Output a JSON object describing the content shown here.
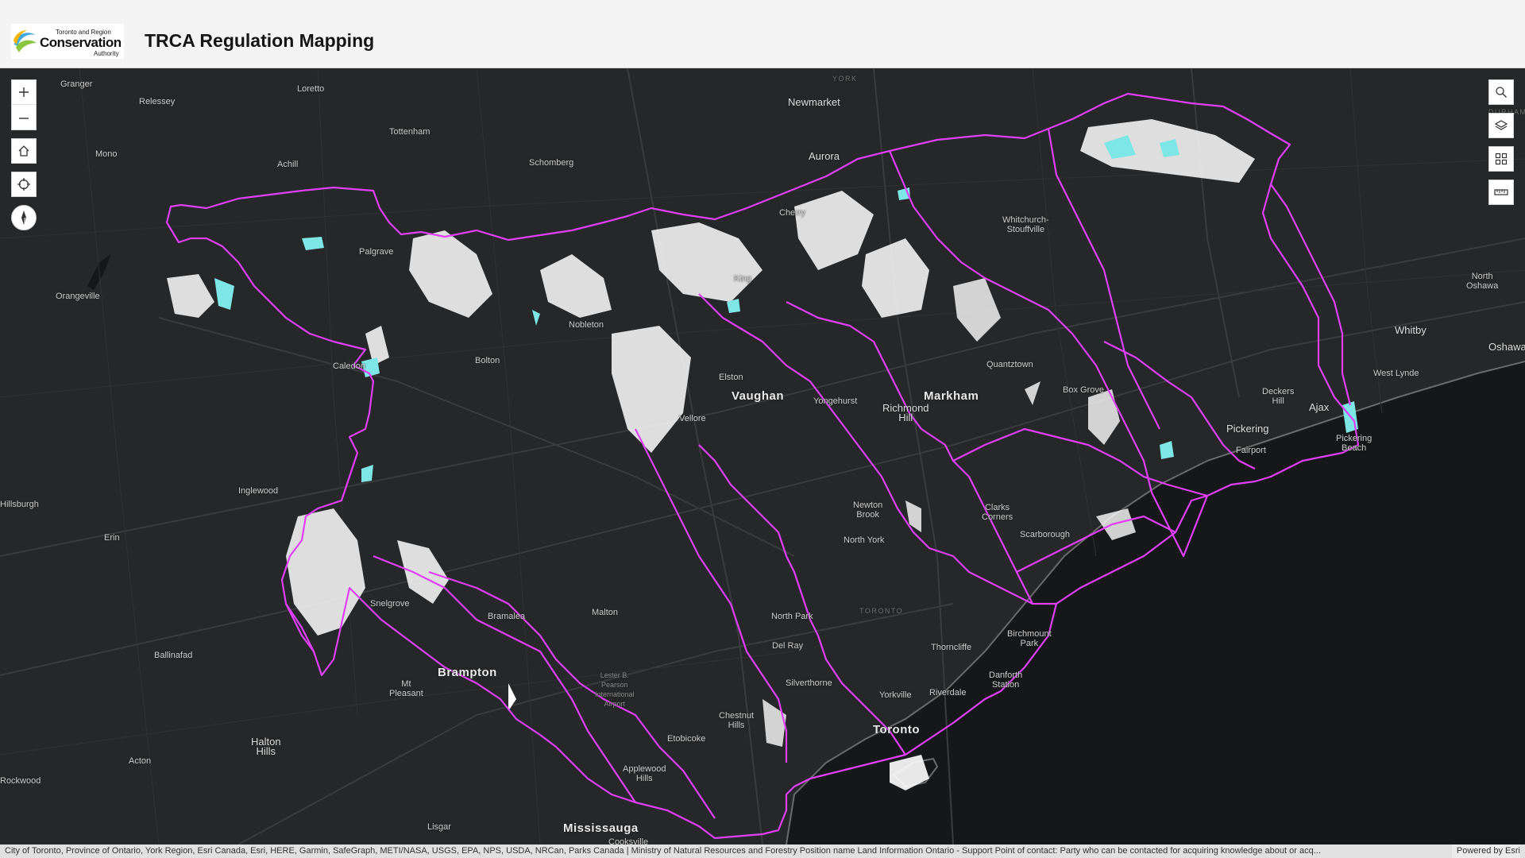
{
  "header": {
    "logo_line1": "Toronto and Region",
    "logo_line2": "Conservation",
    "logo_line3": "Authority",
    "title": "TRCA Regulation Mapping"
  },
  "colors": {
    "watershed_boundary": "#e040fb",
    "regulation_area": "#ffffff",
    "wetland": "#7fe6e6",
    "basemap": "#262728",
    "lake": "#161718"
  },
  "map_controls": {
    "left": [
      "zoom-in",
      "zoom-out",
      "home",
      "locate",
      "compass"
    ],
    "right": [
      "search",
      "layer-list",
      "basemap-gallery",
      "measure"
    ]
  },
  "places": {
    "granger": "Granger",
    "loretto": "Loretto",
    "relessey": "Relessey",
    "tottenham": "Tottenham",
    "mono": "Mono",
    "achill": "Achill",
    "schomberg": "Schomberg",
    "newmarket": "Newmarket",
    "aurora": "Aurora",
    "york": "YORK",
    "durham": "DURHAM",
    "cherry": "Cherry",
    "palgrave": "Palgrave",
    "whitchurch": "Whitchurch-\nStouffville",
    "orangeville": "Orangeville",
    "king": "King",
    "nobleton": "Nobleton",
    "north_oshawa": "North\nOshawa",
    "whitby": "Whitby",
    "oshawa": "Oshawa",
    "bolton": "Bolton",
    "caledon": "Caledon",
    "kleinburg": "Elston",
    "quantztown": "Quantztown",
    "vaughan": "Vaughan",
    "markham": "Markham",
    "yongehurst": "Yongehurst",
    "richmond_hill": "Richmond\nHill",
    "box_grove": "Box Grove",
    "deckers_hill": "Deckers\nHill",
    "ajax": "Ajax",
    "west_lynde": "West Lynde",
    "vellore": "Vellore",
    "pickering": "Pickering",
    "pickering_beach": "Pickering\nBeach",
    "fairport": "Fairport",
    "hillsburgh": "Hillsburgh",
    "inglewood": "Inglewood",
    "newton_brook": "Newton\nBrook",
    "clarks_corners": "Clarks\nCorners",
    "erin": "Erin",
    "north_york": "North York",
    "scarborough": "Scarborough",
    "snelgrove": "Snelgrove",
    "bramalea": "Bramalea",
    "malton": "Malton",
    "toronto_region": "TORONTO",
    "north_park": "North Park",
    "birchmount_park": "Birchmount\nPark",
    "ballinafad": "Ballinafad",
    "del_ray": "Del Ray",
    "thorncliffe": "Thorncliffe",
    "brampton": "Brampton",
    "pearson": "Lester B.\nPearson\nInternational\nAirport",
    "mt_pleasant": "Mt\nPleasant",
    "silverthorne": "Silverthorne",
    "danforth_station": "Danforth\nStation",
    "yorkville": "Yorkville",
    "riverdale": "Riverdale",
    "chestnut_hills": "Chestnut\nHills",
    "halton_hills": "Halton\nHills",
    "toronto": "Toronto",
    "etobicoke": "Etobicoke",
    "acton": "Acton",
    "applewood_hills": "Applewood\nHills",
    "rockwood": "Rockwood",
    "lisgar": "Lisgar",
    "mississauga": "Mississauga",
    "cooksville": "Cooksville"
  },
  "attribution": {
    "text": "City of Toronto, Province of Ontario, York Region, Esri Canada, Esri, HERE, Garmin, SafeGraph, METI/NASA, USGS, EPA, NPS, USDA, NRCan, Parks Canada | Ministry of Natural Resources and Forestry Position name Land Information Ontario - Support Point of contact: Party who can be contacted for acquiring knowledge about or acq...",
    "powered_by": "Powered by Esri"
  }
}
